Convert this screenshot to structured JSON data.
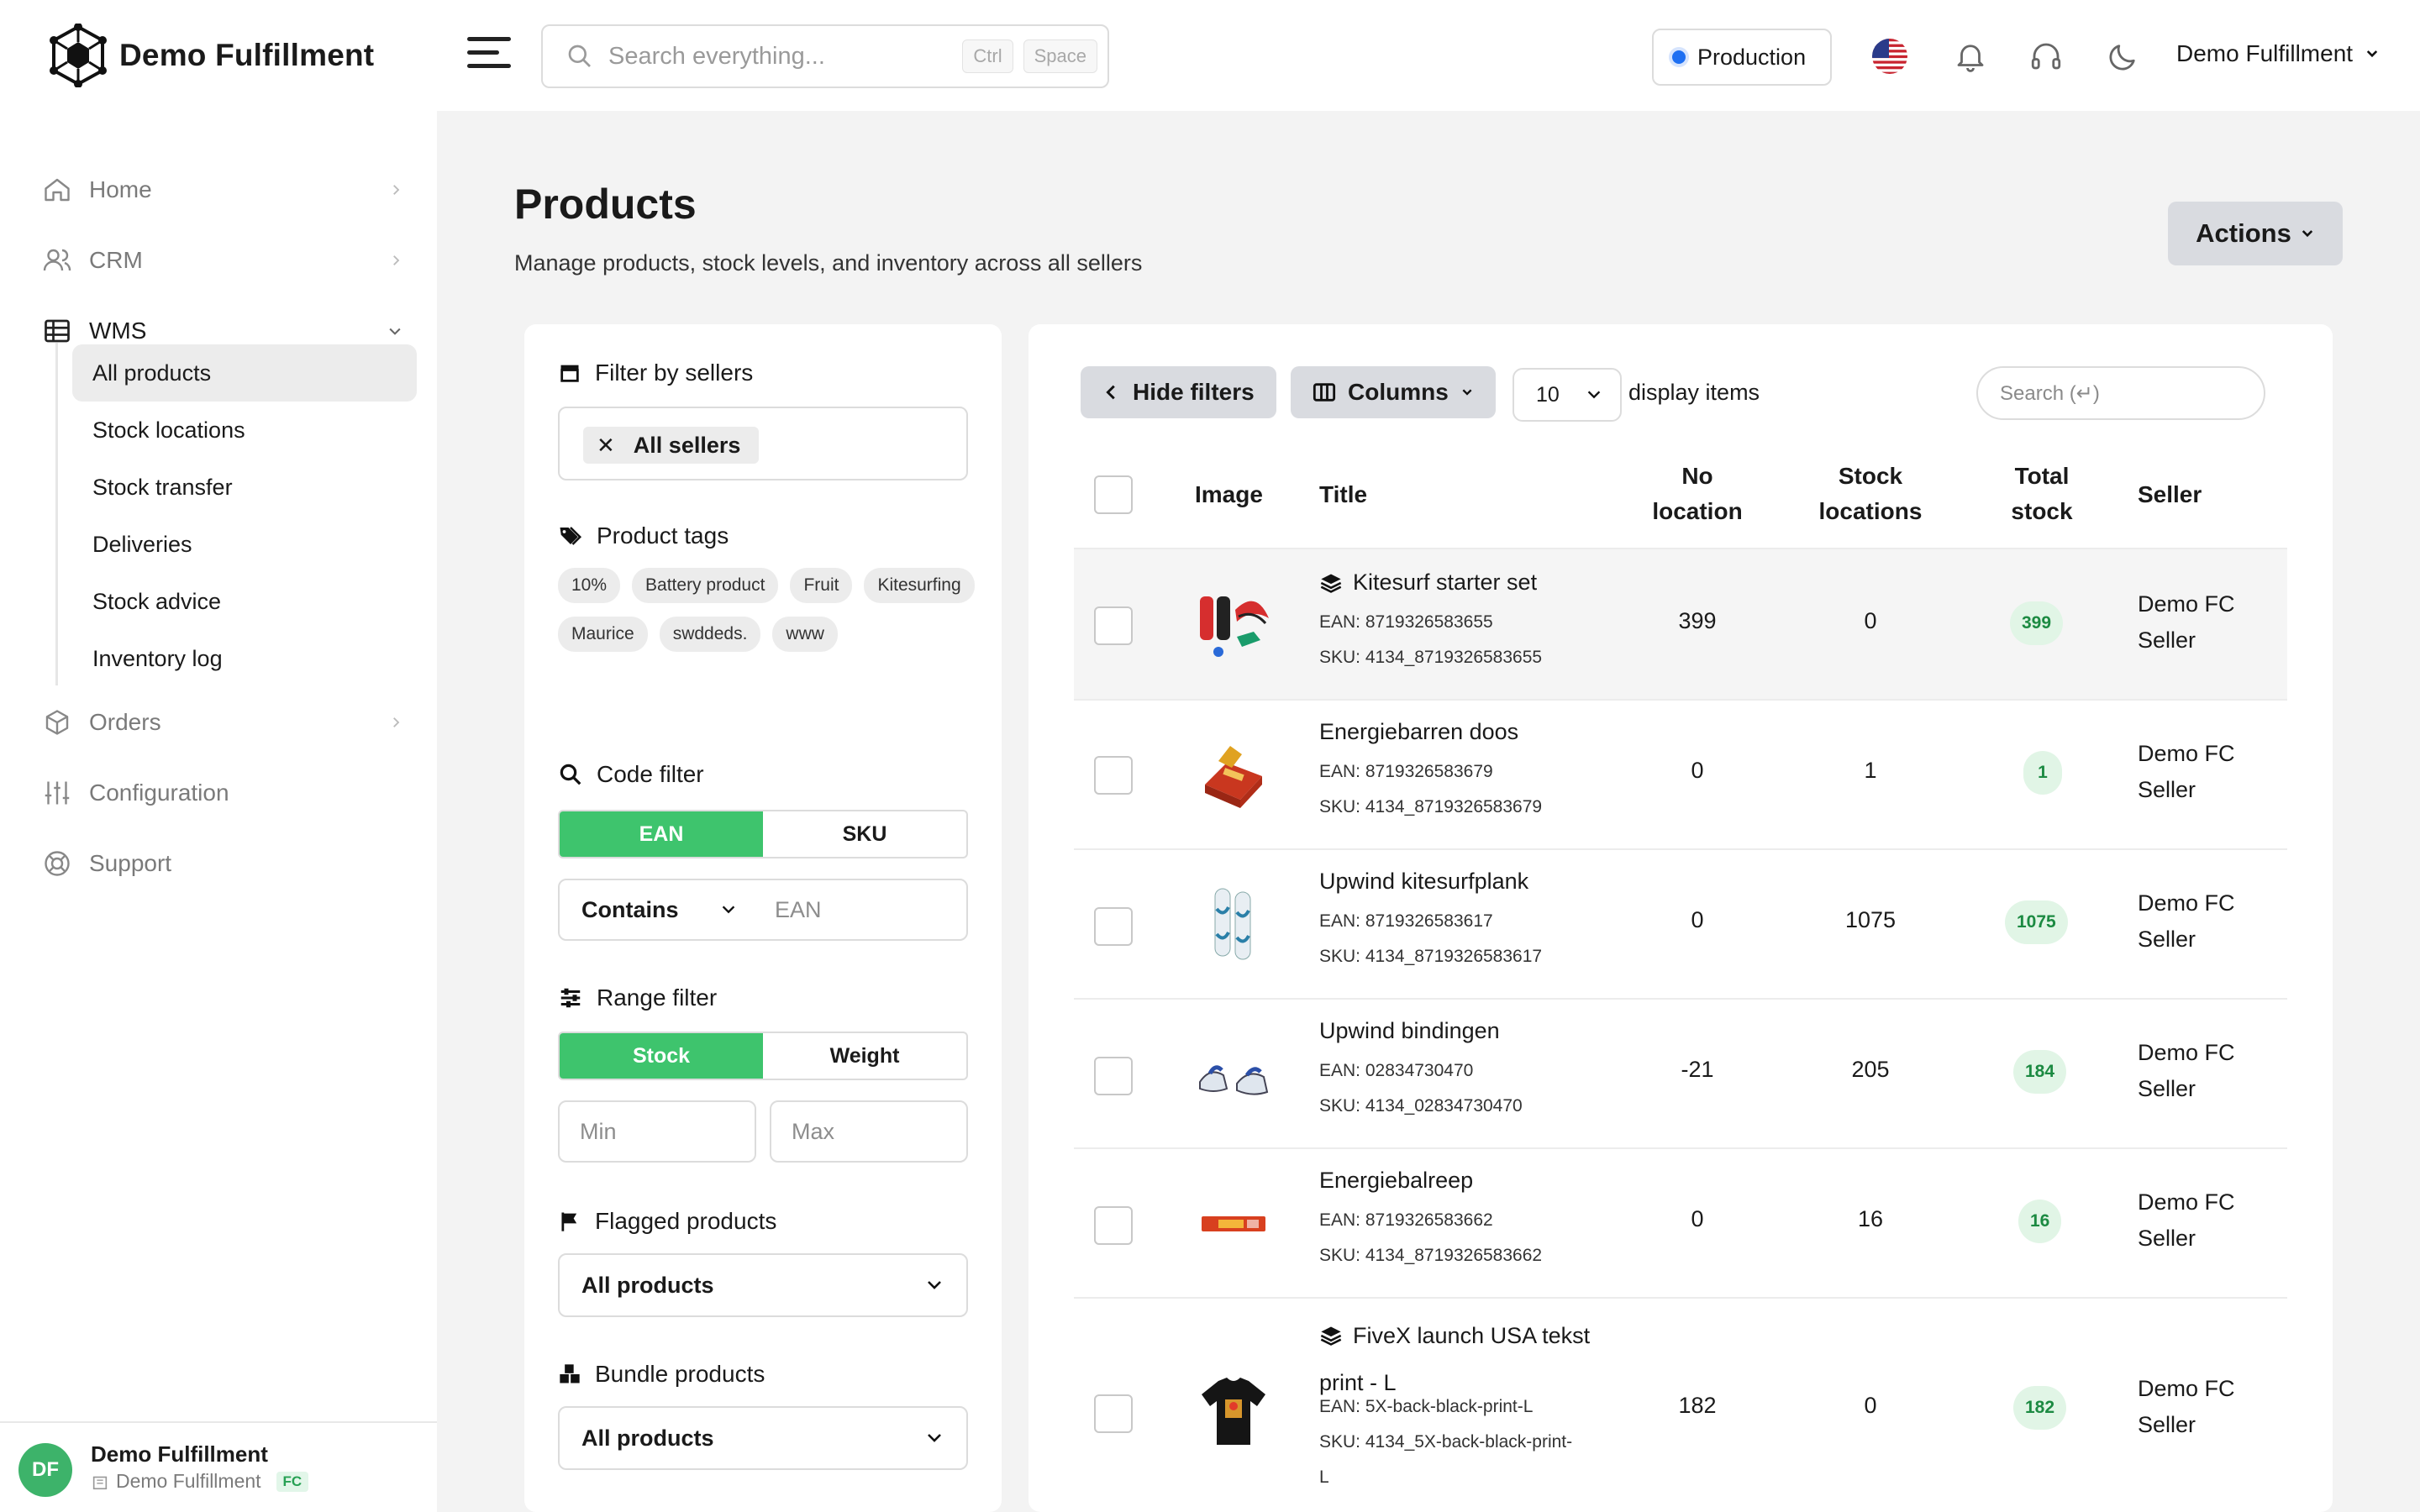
{
  "header": {
    "brand": "Demo Fulfillment",
    "search_placeholder": "Search everything...",
    "kbd_ctrl": "Ctrl",
    "kbd_space": "Space",
    "environment": "Production",
    "user_menu": "Demo Fulfillment"
  },
  "sidebar": {
    "items": [
      {
        "label": "Home"
      },
      {
        "label": "CRM"
      },
      {
        "label": "WMS"
      },
      {
        "label": "Orders"
      },
      {
        "label": "Configuration"
      },
      {
        "label": "Support"
      }
    ],
    "wms_sub": [
      {
        "label": "All products"
      },
      {
        "label": "Stock locations"
      },
      {
        "label": "Stock transfer"
      },
      {
        "label": "Deliveries"
      },
      {
        "label": "Stock advice"
      },
      {
        "label": "Inventory log"
      }
    ],
    "footer": {
      "avatar": "DF",
      "name": "Demo Fulfillment",
      "sub": "Demo Fulfillment",
      "badge": "FC"
    }
  },
  "page": {
    "title": "Products",
    "subtitle": "Manage products, stock levels, and inventory across all sellers",
    "actions_label": "Actions"
  },
  "filters": {
    "sellers_title": "Filter by sellers",
    "sellers_chip": "All sellers",
    "tags_title": "Product tags",
    "tags": [
      "10%",
      "Battery product",
      "Fruit",
      "Kitesurfing",
      "Maurice",
      "swddeds.",
      "www"
    ],
    "code_title": "Code filter",
    "code_ean": "EAN",
    "code_sku": "SKU",
    "code_mode": "Contains",
    "code_placeholder": "EAN",
    "range_title": "Range filter",
    "range_stock": "Stock",
    "range_weight": "Weight",
    "range_min": "Min",
    "range_max": "Max",
    "flagged_title": "Flagged products",
    "flagged_value": "All products",
    "bundle_title": "Bundle products",
    "bundle_value": "All products"
  },
  "table": {
    "hide_filters": "Hide filters",
    "columns": "Columns",
    "page_size": "10",
    "display_items": "display items",
    "search_placeholder": "Search (↵)",
    "headers": {
      "image": "Image",
      "title": "Title",
      "no_location_1": "No",
      "no_location_2": "location",
      "stock_locations_1": "Stock",
      "stock_locations_2": "locations",
      "total_stock_1": "Total",
      "total_stock_2": "stock",
      "seller": "Seller"
    },
    "rows": [
      {
        "title": "Kitesurf starter set",
        "bundle": true,
        "ean": "EAN: 8719326583655",
        "sku": "SKU: 4134_8719326583655",
        "no_location": "399",
        "stock_locations": "0",
        "total": "399",
        "seller1": "Demo FC",
        "seller2": "Seller"
      },
      {
        "title": "Energiebarren doos",
        "bundle": false,
        "ean": "EAN: 8719326583679",
        "sku": "SKU: 4134_8719326583679",
        "no_location": "0",
        "stock_locations": "1",
        "total": "1",
        "seller1": "Demo FC",
        "seller2": "Seller"
      },
      {
        "title": "Upwind kitesurfplank",
        "bundle": false,
        "ean": "EAN: 8719326583617",
        "sku": "SKU: 4134_8719326583617",
        "no_location": "0",
        "stock_locations": "1075",
        "total": "1075",
        "seller1": "Demo FC",
        "seller2": "Seller"
      },
      {
        "title": "Upwind bindingen",
        "bundle": false,
        "ean": "EAN: 02834730470",
        "sku": "SKU: 4134_02834730470",
        "no_location": "-21",
        "stock_locations": "205",
        "total": "184",
        "seller1": "Demo FC",
        "seller2": "Seller"
      },
      {
        "title": "Energiebalreep",
        "bundle": false,
        "ean": "EAN: 8719326583662",
        "sku": "SKU: 4134_8719326583662",
        "no_location": "0",
        "stock_locations": "16",
        "total": "16",
        "seller1": "Demo FC",
        "seller2": "Seller"
      },
      {
        "title": "FiveX launch USA tekst",
        "title2": "print - L",
        "bundle": true,
        "ean": "EAN: 5X-back-black-print-L",
        "sku": "SKU: 4134_5X-back-black-print-",
        "sku2": "L",
        "no_location": "182",
        "stock_locations": "0",
        "total": "182",
        "seller1": "Demo FC",
        "seller2": "Seller"
      }
    ]
  },
  "colors": {
    "accent_green": "#3ec46d",
    "env_dot": "#1e6ff2",
    "stock_badge_bg": "#e1f5e6",
    "stock_badge_text": "#1c8a42"
  }
}
